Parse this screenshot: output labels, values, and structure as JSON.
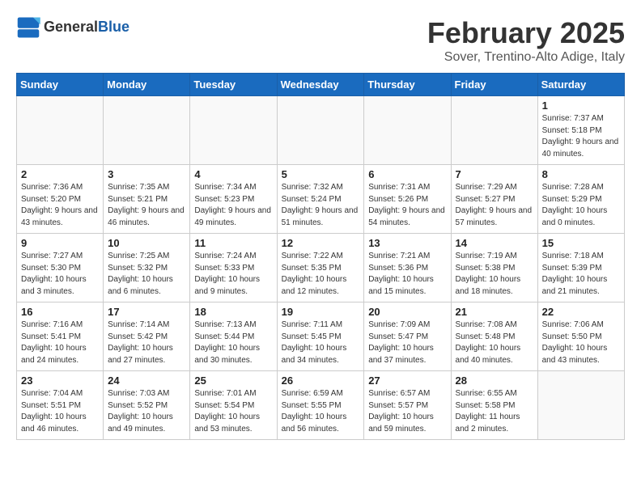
{
  "logo": {
    "general": "General",
    "blue": "Blue"
  },
  "header": {
    "title": "February 2025",
    "subtitle": "Sover, Trentino-Alto Adige, Italy"
  },
  "days_of_week": [
    "Sunday",
    "Monday",
    "Tuesday",
    "Wednesday",
    "Thursday",
    "Friday",
    "Saturday"
  ],
  "weeks": [
    [
      {
        "day": "",
        "info": ""
      },
      {
        "day": "",
        "info": ""
      },
      {
        "day": "",
        "info": ""
      },
      {
        "day": "",
        "info": ""
      },
      {
        "day": "",
        "info": ""
      },
      {
        "day": "",
        "info": ""
      },
      {
        "day": "1",
        "info": "Sunrise: 7:37 AM\nSunset: 5:18 PM\nDaylight: 9 hours and 40 minutes."
      }
    ],
    [
      {
        "day": "2",
        "info": "Sunrise: 7:36 AM\nSunset: 5:20 PM\nDaylight: 9 hours and 43 minutes."
      },
      {
        "day": "3",
        "info": "Sunrise: 7:35 AM\nSunset: 5:21 PM\nDaylight: 9 hours and 46 minutes."
      },
      {
        "day": "4",
        "info": "Sunrise: 7:34 AM\nSunset: 5:23 PM\nDaylight: 9 hours and 49 minutes."
      },
      {
        "day": "5",
        "info": "Sunrise: 7:32 AM\nSunset: 5:24 PM\nDaylight: 9 hours and 51 minutes."
      },
      {
        "day": "6",
        "info": "Sunrise: 7:31 AM\nSunset: 5:26 PM\nDaylight: 9 hours and 54 minutes."
      },
      {
        "day": "7",
        "info": "Sunrise: 7:29 AM\nSunset: 5:27 PM\nDaylight: 9 hours and 57 minutes."
      },
      {
        "day": "8",
        "info": "Sunrise: 7:28 AM\nSunset: 5:29 PM\nDaylight: 10 hours and 0 minutes."
      }
    ],
    [
      {
        "day": "9",
        "info": "Sunrise: 7:27 AM\nSunset: 5:30 PM\nDaylight: 10 hours and 3 minutes."
      },
      {
        "day": "10",
        "info": "Sunrise: 7:25 AM\nSunset: 5:32 PM\nDaylight: 10 hours and 6 minutes."
      },
      {
        "day": "11",
        "info": "Sunrise: 7:24 AM\nSunset: 5:33 PM\nDaylight: 10 hours and 9 minutes."
      },
      {
        "day": "12",
        "info": "Sunrise: 7:22 AM\nSunset: 5:35 PM\nDaylight: 10 hours and 12 minutes."
      },
      {
        "day": "13",
        "info": "Sunrise: 7:21 AM\nSunset: 5:36 PM\nDaylight: 10 hours and 15 minutes."
      },
      {
        "day": "14",
        "info": "Sunrise: 7:19 AM\nSunset: 5:38 PM\nDaylight: 10 hours and 18 minutes."
      },
      {
        "day": "15",
        "info": "Sunrise: 7:18 AM\nSunset: 5:39 PM\nDaylight: 10 hours and 21 minutes."
      }
    ],
    [
      {
        "day": "16",
        "info": "Sunrise: 7:16 AM\nSunset: 5:41 PM\nDaylight: 10 hours and 24 minutes."
      },
      {
        "day": "17",
        "info": "Sunrise: 7:14 AM\nSunset: 5:42 PM\nDaylight: 10 hours and 27 minutes."
      },
      {
        "day": "18",
        "info": "Sunrise: 7:13 AM\nSunset: 5:44 PM\nDaylight: 10 hours and 30 minutes."
      },
      {
        "day": "19",
        "info": "Sunrise: 7:11 AM\nSunset: 5:45 PM\nDaylight: 10 hours and 34 minutes."
      },
      {
        "day": "20",
        "info": "Sunrise: 7:09 AM\nSunset: 5:47 PM\nDaylight: 10 hours and 37 minutes."
      },
      {
        "day": "21",
        "info": "Sunrise: 7:08 AM\nSunset: 5:48 PM\nDaylight: 10 hours and 40 minutes."
      },
      {
        "day": "22",
        "info": "Sunrise: 7:06 AM\nSunset: 5:50 PM\nDaylight: 10 hours and 43 minutes."
      }
    ],
    [
      {
        "day": "23",
        "info": "Sunrise: 7:04 AM\nSunset: 5:51 PM\nDaylight: 10 hours and 46 minutes."
      },
      {
        "day": "24",
        "info": "Sunrise: 7:03 AM\nSunset: 5:52 PM\nDaylight: 10 hours and 49 minutes."
      },
      {
        "day": "25",
        "info": "Sunrise: 7:01 AM\nSunset: 5:54 PM\nDaylight: 10 hours and 53 minutes."
      },
      {
        "day": "26",
        "info": "Sunrise: 6:59 AM\nSunset: 5:55 PM\nDaylight: 10 hours and 56 minutes."
      },
      {
        "day": "27",
        "info": "Sunrise: 6:57 AM\nSunset: 5:57 PM\nDaylight: 10 hours and 59 minutes."
      },
      {
        "day": "28",
        "info": "Sunrise: 6:55 AM\nSunset: 5:58 PM\nDaylight: 11 hours and 2 minutes."
      },
      {
        "day": "",
        "info": ""
      }
    ]
  ]
}
